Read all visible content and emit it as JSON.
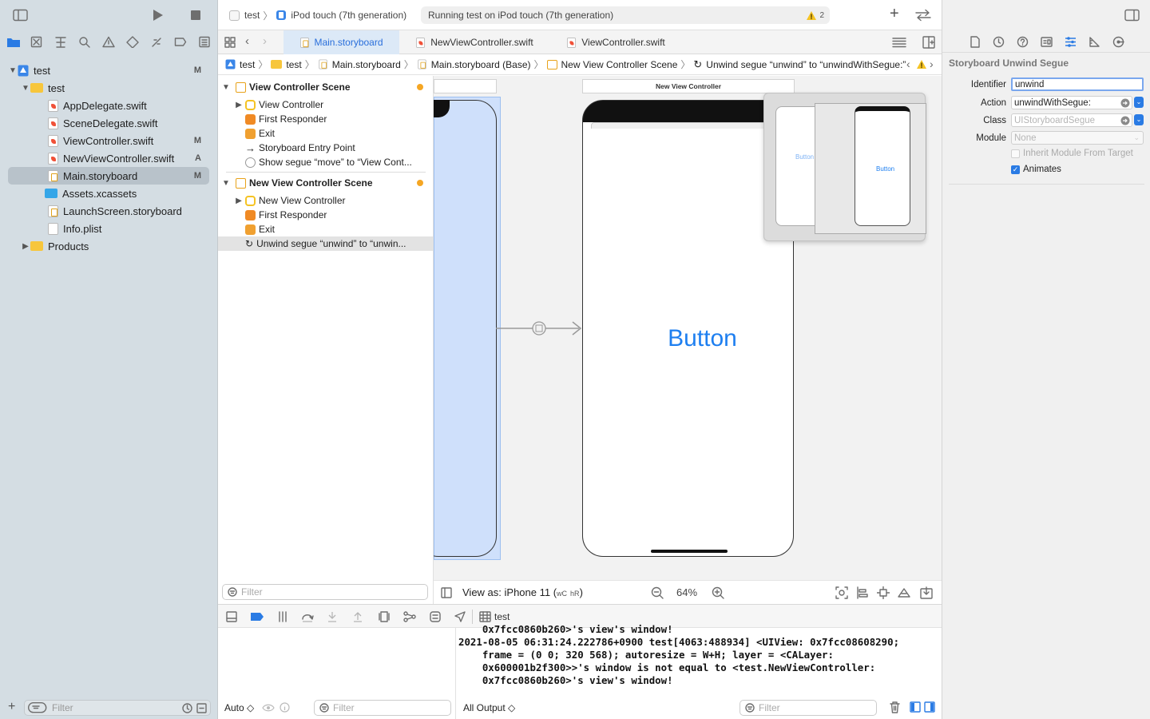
{
  "navigator": {
    "items": [
      {
        "label": "test",
        "status": "M"
      },
      {
        "label": "test",
        "status": ""
      },
      {
        "label": "AppDelegate.swift",
        "status": ""
      },
      {
        "label": "SceneDelegate.swift",
        "status": ""
      },
      {
        "label": "ViewController.swift",
        "status": "M"
      },
      {
        "label": "NewViewController.swift",
        "status": "A"
      },
      {
        "label": "Main.storyboard",
        "status": "M"
      },
      {
        "label": "Assets.xcassets",
        "status": ""
      },
      {
        "label": "LaunchScreen.storyboard",
        "status": ""
      },
      {
        "label": "Info.plist",
        "status": ""
      },
      {
        "label": "Products",
        "status": ""
      }
    ],
    "filter_placeholder": "Filter"
  },
  "toolbar": {
    "scheme": "test",
    "destination": "iPod touch (7th generation)",
    "activity": "Running test on iPod touch (7th generation)",
    "warning_count": "2"
  },
  "tabs": [
    {
      "label": "Main.storyboard"
    },
    {
      "label": "NewViewController.swift"
    },
    {
      "label": "ViewController.swift"
    }
  ],
  "jumpbar": [
    "test",
    "test",
    "Main.storyboard",
    "Main.storyboard (Base)",
    "New View Controller Scene",
    "Unwind segue “unwind” to “unwindWithSegue:”"
  ],
  "outline": {
    "scene1": "View Controller Scene",
    "scene1_items": [
      "View Controller",
      "First Responder",
      "Exit",
      "Storyboard Entry Point",
      "Show segue “move” to “View Cont..."
    ],
    "scene2": "New View Controller Scene",
    "scene2_items": [
      "New View Controller",
      "First Responder",
      "Exit",
      "Unwind segue “unwind” to “unwin..."
    ],
    "filter_placeholder": "Filter"
  },
  "canvas": {
    "scene_title": "New View Controller",
    "button_label": "Button",
    "mini_button1": "Button",
    "mini_button2": "Button",
    "view_as": "View as: iPhone 11 (",
    "size_w": "wC",
    "size_h": "hR",
    "view_as_end": ")",
    "zoom": "64%"
  },
  "debug": {
    "process": "test",
    "auto": "Auto ◇",
    "filter_placeholder": "Filter",
    "all_output": "All Output ◇",
    "log": "    0x7fcc0860b260>'s view's window!\n2021-08-05 06:31:24.222786+0900 test[4063:488934] <UIView: 0x7fcc08608290;\n    frame = (0 0; 320 568); autoresize = W+H; layer = <CALayer:\n    0x600001b2f300>>'s window is not equal to <test.NewViewController:\n    0x7fcc0860b260>'s view's window!"
  },
  "inspector": {
    "title": "Storyboard Unwind Segue",
    "identifier_label": "Identifier",
    "identifier_value": "unwind",
    "action_label": "Action",
    "action_value": "unwindWithSegue:",
    "class_label": "Class",
    "class_placeholder": "UIStoryboardSegue",
    "module_label": "Module",
    "module_value": "None",
    "inherit_label": "Inherit Module From Target",
    "animates_label": "Animates"
  },
  "colors": {
    "accent": "#2a6fdb",
    "selection": "#b8c2ca",
    "warning": "#f5a623"
  }
}
